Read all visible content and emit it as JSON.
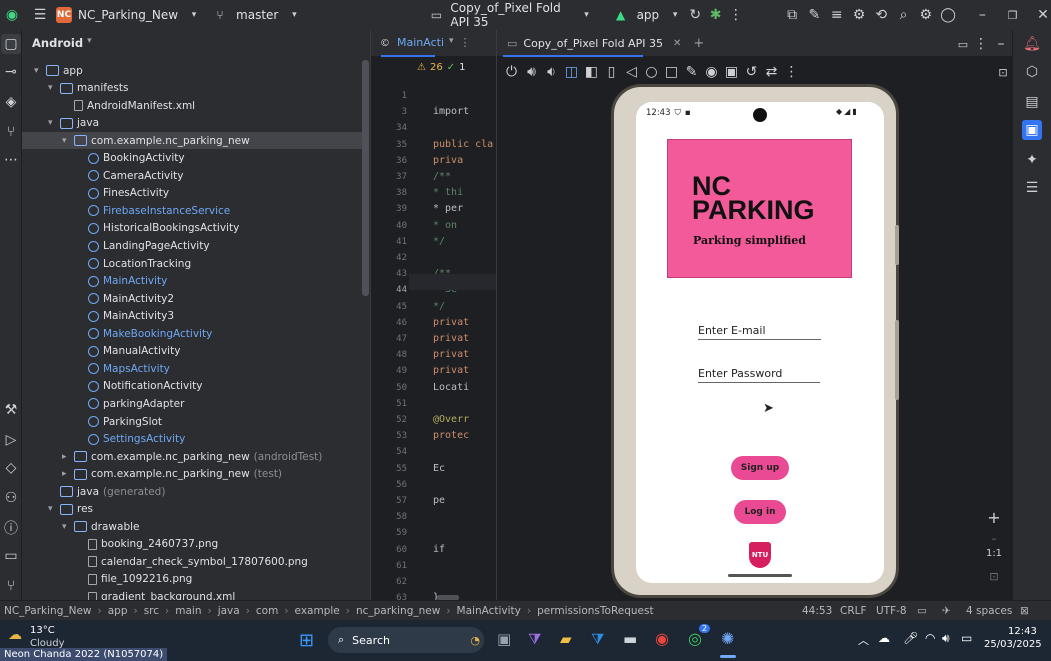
{
  "titlebar": {
    "project_badge": "NC",
    "project_name": "NC_Parking_New",
    "branch": "master",
    "device": "Copy_of_Pixel Fold API 35",
    "run_config": "app"
  },
  "project_panel": {
    "title": "Android",
    "tree": [
      {
        "label": "app",
        "indent": 1,
        "kind": "folder",
        "arrow": "▾"
      },
      {
        "label": "manifests",
        "indent": 2,
        "kind": "folder",
        "arrow": "▾"
      },
      {
        "label": "AndroidManifest.xml",
        "indent": 3,
        "kind": "file",
        "arrow": ""
      },
      {
        "label": "java",
        "indent": 2,
        "kind": "folder",
        "arrow": "▾"
      },
      {
        "label": "com.example.nc_parking_new",
        "indent": 3,
        "kind": "folder",
        "arrow": "▾",
        "selected": true
      },
      {
        "label": "BookingActivity",
        "indent": 4,
        "kind": "class",
        "arrow": ""
      },
      {
        "label": "CameraActivity",
        "indent": 4,
        "kind": "class",
        "arrow": ""
      },
      {
        "label": "FinesActivity",
        "indent": 4,
        "kind": "class",
        "arrow": ""
      },
      {
        "label": "FirebaseInstanceService",
        "indent": 4,
        "kind": "class",
        "arrow": "",
        "blue": true
      },
      {
        "label": "HistoricalBookingsActivity",
        "indent": 4,
        "kind": "class",
        "arrow": ""
      },
      {
        "label": "LandingPageActivity",
        "indent": 4,
        "kind": "class",
        "arrow": ""
      },
      {
        "label": "LocationTracking",
        "indent": 4,
        "kind": "class",
        "arrow": ""
      },
      {
        "label": "MainActivity",
        "indent": 4,
        "kind": "class",
        "arrow": "",
        "blue": true
      },
      {
        "label": "MainActivity2",
        "indent": 4,
        "kind": "class",
        "arrow": ""
      },
      {
        "label": "MainActivity3",
        "indent": 4,
        "kind": "class",
        "arrow": ""
      },
      {
        "label": "MakeBookingActivity",
        "indent": 4,
        "kind": "class",
        "arrow": "",
        "blue": true
      },
      {
        "label": "ManualActivity",
        "indent": 4,
        "kind": "class",
        "arrow": ""
      },
      {
        "label": "MapsActivity",
        "indent": 4,
        "kind": "class",
        "arrow": "",
        "blue": true
      },
      {
        "label": "NotificationActivity",
        "indent": 4,
        "kind": "class",
        "arrow": ""
      },
      {
        "label": "parkingAdapter",
        "indent": 4,
        "kind": "class",
        "arrow": ""
      },
      {
        "label": "ParkingSlot",
        "indent": 4,
        "kind": "class",
        "arrow": ""
      },
      {
        "label": "SettingsActivity",
        "indent": 4,
        "kind": "class",
        "arrow": "",
        "blue": true
      },
      {
        "label": "com.example.nc_parking_new",
        "suffix": "(androidTest)",
        "indent": 3,
        "kind": "folder",
        "arrow": "▸"
      },
      {
        "label": "com.example.nc_parking_new",
        "suffix": "(test)",
        "indent": 3,
        "kind": "folder",
        "arrow": "▸"
      },
      {
        "label": "java",
        "suffix": "(generated)",
        "indent": 2,
        "kind": "folder",
        "arrow": ""
      },
      {
        "label": "res",
        "indent": 2,
        "kind": "folder",
        "arrow": "▾"
      },
      {
        "label": "drawable",
        "indent": 3,
        "kind": "folder",
        "arrow": "▾"
      },
      {
        "label": "booking_2460737.png",
        "indent": 4,
        "kind": "file",
        "arrow": ""
      },
      {
        "label": "calendar_check_symbol_17807600.png",
        "indent": 4,
        "kind": "file",
        "arrow": ""
      },
      {
        "label": "file_1092216.png",
        "indent": 4,
        "kind": "file",
        "arrow": ""
      },
      {
        "label": "gradient_background.xml",
        "indent": 4,
        "kind": "file",
        "arrow": ""
      }
    ]
  },
  "editor": {
    "tab": "MainActivi",
    "warnings": "26",
    "checks": "1",
    "lines": [
      {
        "n": "1",
        "code": ""
      },
      {
        "n": "3",
        "code": "import"
      },
      {
        "n": "34",
        "code": ""
      },
      {
        "n": "35",
        "code": "public cla"
      },
      {
        "n": "36",
        "code": "  priva"
      },
      {
        "n": "37",
        "code": "  /**"
      },
      {
        "n": "38",
        "code": "   * thi"
      },
      {
        "n": "39",
        "code": "   * per"
      },
      {
        "n": "40",
        "code": "   * on"
      },
      {
        "n": "41",
        "code": "   */"
      },
      {
        "n": "42",
        "code": ""
      },
      {
        "n": "43",
        "code": "  /**"
      },
      {
        "n": "44",
        "code": "   * Se"
      },
      {
        "n": "45",
        "code": "   */"
      },
      {
        "n": "46",
        "code": "  privat"
      },
      {
        "n": "47",
        "code": "  privat"
      },
      {
        "n": "48",
        "code": "  privat"
      },
      {
        "n": "49",
        "code": "  privat"
      },
      {
        "n": "50",
        "code": "  Locati"
      },
      {
        "n": "51",
        "code": ""
      },
      {
        "n": "52",
        "code": "  @Overr"
      },
      {
        "n": "53",
        "code": "  protec"
      },
      {
        "n": "54",
        "code": ""
      },
      {
        "n": "55",
        "code": "     Ec"
      },
      {
        "n": "56",
        "code": ""
      },
      {
        "n": "57",
        "code": "     pe"
      },
      {
        "n": "58",
        "code": ""
      },
      {
        "n": "59",
        "code": ""
      },
      {
        "n": "60",
        "code": "     if"
      },
      {
        "n": "61",
        "code": ""
      },
      {
        "n": "62",
        "code": ""
      },
      {
        "n": "63",
        "code": "  }"
      }
    ]
  },
  "emulator": {
    "tab": "Copy_of_Pixel Fold API 35",
    "zoom_label": "1:1"
  },
  "phone": {
    "time": "12:43",
    "logo_line1": "NC",
    "logo_line2": "PARKING",
    "logo_tagline": "Parking simplified",
    "email_label": "Enter E-mail",
    "password_label": "Enter Password",
    "signup_label": "Sign up",
    "login_label": "Log in",
    "badge_label": "NTU",
    "logo_color": "#f25a9a",
    "button_color": "#e94a93"
  },
  "statusbar": {
    "breadcrumb": [
      "NC_Parking_New",
      "app",
      "src",
      "main",
      "java",
      "com",
      "example",
      "nc_parking_new",
      "MainActivity",
      "permissionsToRequest"
    ],
    "position": "44:53",
    "line_ending": "CRLF",
    "encoding": "UTF-8",
    "indent": "4 spaces"
  },
  "taskbar": {
    "temperature": "13°C",
    "weather": "Cloudy",
    "search_label": "Search",
    "whatsapp_count": "2",
    "clock_time": "12:43",
    "clock_date": "25/03/2025",
    "watermark": "Neon Chanda 2022 (N1057074)"
  }
}
